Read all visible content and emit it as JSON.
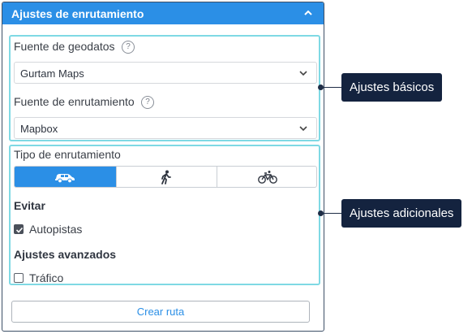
{
  "panel": {
    "title": "Ajustes de enrutamiento",
    "collapse_icon": "chevron-up-icon"
  },
  "basic": {
    "geo_label": "Fuente de geodatos",
    "geo_value": "Gurtam Maps",
    "routing_source_label": "Fuente de enrutamiento",
    "routing_source_value": "Mapbox",
    "help_glyph": "?"
  },
  "routing_type": {
    "label": "Tipo de enrutamiento",
    "options": [
      {
        "icon": "car-icon",
        "active": true
      },
      {
        "icon": "walking-icon",
        "active": false
      },
      {
        "icon": "bicycle-icon",
        "active": false
      }
    ]
  },
  "avoid": {
    "label": "Evitar",
    "highways_label": "Autopistas",
    "highways_checked": true
  },
  "advanced": {
    "label": "Ajustes avanzados",
    "traffic_label": "Tráfico",
    "traffic_checked": false
  },
  "create_button": "Crear ruta",
  "callouts": {
    "basic": "Ajustes básicos",
    "additional": "Ajustes adicionales"
  },
  "colors": {
    "accent": "#2b8fe6",
    "group_border": "#7fd9e4",
    "callout_bg": "#14233f"
  }
}
